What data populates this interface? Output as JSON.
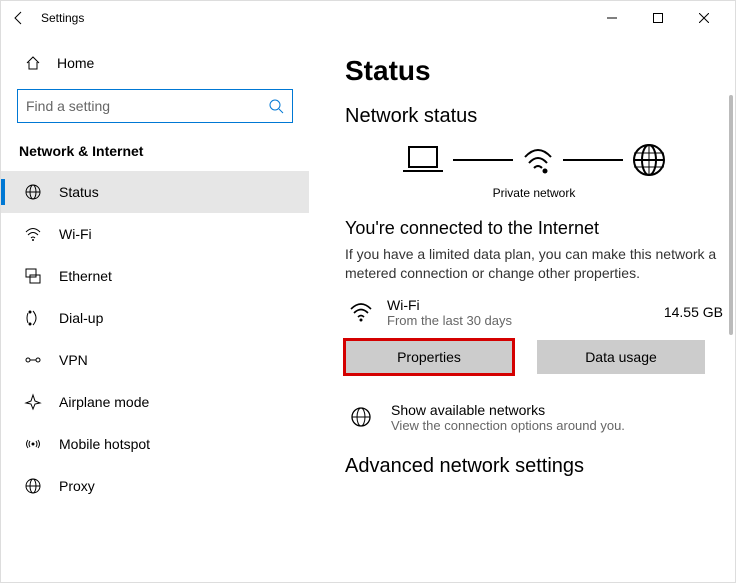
{
  "window": {
    "title": "Settings"
  },
  "sidebar": {
    "home": "Home",
    "search_placeholder": "Find a setting",
    "section": "Network & Internet",
    "items": [
      {
        "label": "Status"
      },
      {
        "label": "Wi-Fi"
      },
      {
        "label": "Ethernet"
      },
      {
        "label": "Dial-up"
      },
      {
        "label": "VPN"
      },
      {
        "label": "Airplane mode"
      },
      {
        "label": "Mobile hotspot"
      },
      {
        "label": "Proxy"
      }
    ]
  },
  "content": {
    "page_title": "Status",
    "status_heading": "Network status",
    "diagram_caption": "Private network",
    "connected_title": "You're connected to the Internet",
    "connected_desc": "If you have a limited data plan, you can make this network a metered connection or change other properties.",
    "connection": {
      "name": "Wi-Fi",
      "sub": "From the last 30 days",
      "usage": "14.55 GB"
    },
    "buttons": {
      "properties": "Properties",
      "data_usage": "Data usage"
    },
    "available": {
      "label": "Show available networks",
      "sub": "View the connection options around you."
    },
    "advanced_heading": "Advanced network settings"
  }
}
